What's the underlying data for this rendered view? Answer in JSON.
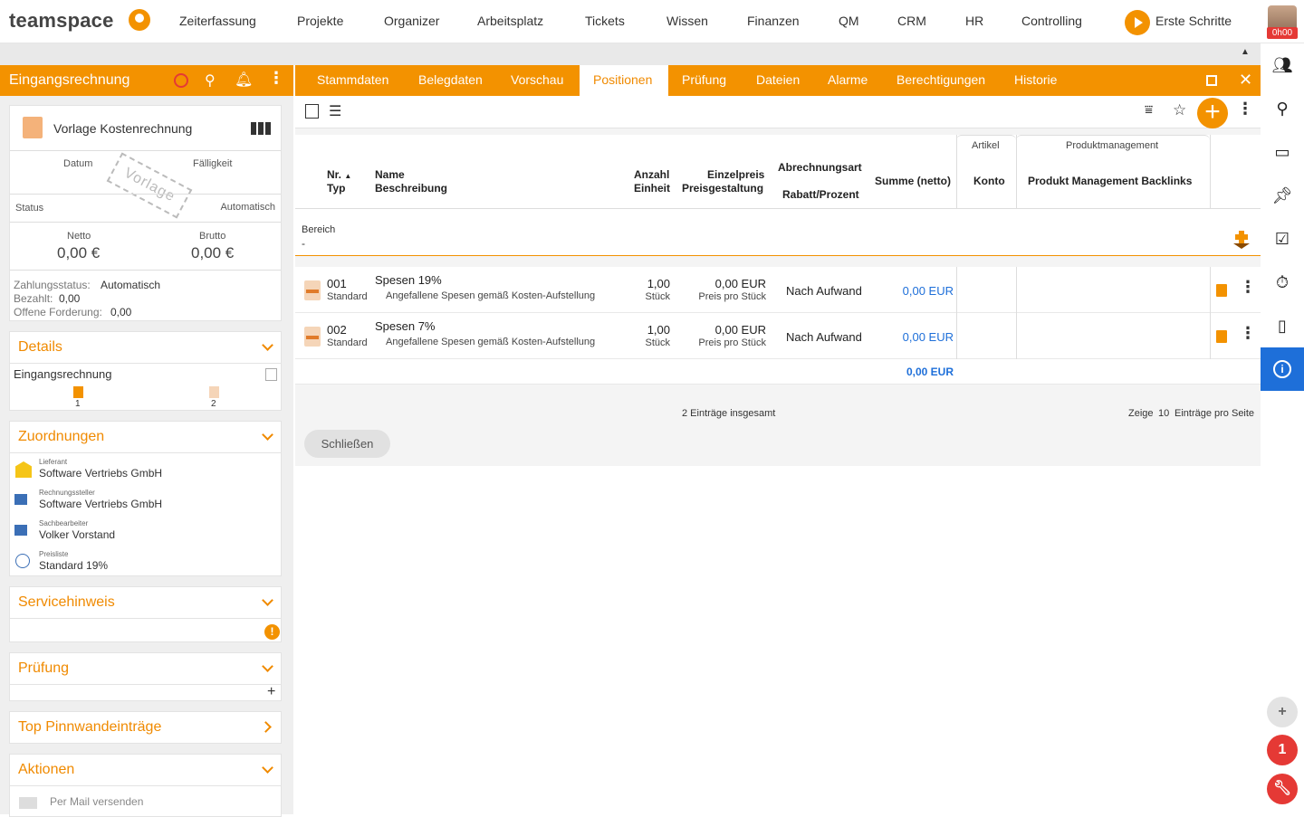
{
  "topbar": {
    "logo": "teamspace",
    "nav": [
      "Zeiterfassung",
      "Projekte",
      "Organizer",
      "Arbeitsplatz",
      "Tickets",
      "Wissen",
      "Finanzen",
      "QM",
      "CRM",
      "HR",
      "Controlling"
    ],
    "erste_schritte": "Erste Schritte",
    "avatar_badge": "0h00"
  },
  "left": {
    "title": "Eingangsrechnung",
    "template_name": "Vorlage Kostenrechnung",
    "datum_label": "Datum",
    "faelligkeit_label": "Fälligkeit",
    "stamp": "Vorlage",
    "status_label": "Status",
    "status_value": "Automatisch",
    "netto_label": "Netto",
    "netto_value": "0,00 €",
    "brutto_label": "Brutto",
    "brutto_value": "0,00 €",
    "zahlungsstatus_label": "Zahlungsstatus:",
    "zahlungsstatus_value": "Automatisch",
    "bezahlt_label": "Bezahlt:",
    "bezahlt_value": "0,00",
    "offen_label": "Offene Forderung:",
    "offen_value": "0,00",
    "details": {
      "title": "Details",
      "type": "Eingangsrechnung",
      "icon1_count": "1",
      "icon2_count": "2"
    },
    "zuordnungen": {
      "title": "Zuordnungen",
      "items": [
        {
          "label": "Lieferant",
          "value": "Software Vertriebs GmbH"
        },
        {
          "label": "Rechnungssteller",
          "value": "Software Vertriebs GmbH"
        },
        {
          "label": "Sachbearbeiter",
          "value": "Volker Vorstand"
        },
        {
          "label": "Preisliste",
          "value": "Standard 19%"
        }
      ]
    },
    "servicehinweis": {
      "title": "Servicehinweis"
    },
    "pruefung": {
      "title": "Prüfung"
    },
    "pinnwand": {
      "title": "Top Pinnwandeinträge"
    },
    "aktionen": {
      "title": "Aktionen",
      "mail": "Per Mail versenden"
    }
  },
  "tabs": [
    "Stammdaten",
    "Belegdaten",
    "Vorschau",
    "Positionen",
    "Prüfung",
    "Dateien",
    "Alarme",
    "Berechtigungen",
    "Historie"
  ],
  "active_tab": "Positionen",
  "table": {
    "headers": {
      "nr": "Nr.",
      "typ": "Typ",
      "name": "Name",
      "beschreibung": "Beschreibung",
      "anzahl": "Anzahl",
      "einheit": "Einheit",
      "einzelpreis": "Einzelpreis",
      "preisgestaltung": "Preisgestaltung",
      "abrechnungsart": "Abrechnungsart",
      "rabatt": "Rabatt/Prozent",
      "summe": "Summe (netto)",
      "artikel_group": "Artikel",
      "konto": "Konto",
      "pm_group": "Produktmanagement",
      "pm_backlinks": "Produkt Management Backlinks"
    },
    "bereich_label": "Bereich",
    "bereich_value": "-",
    "rows": [
      {
        "nr": "001",
        "typ": "Standard",
        "name": "Spesen 19%",
        "beschreibung": "Angefallene Spesen gemäß Kosten-Aufstellung",
        "anzahl": "1,00",
        "einheit": "Stück",
        "einzelpreis": "0,00 EUR",
        "preisgestaltung": "Preis pro Stück",
        "abrechnungsart": "Nach Aufwand",
        "summe": "0,00 EUR"
      },
      {
        "nr": "002",
        "typ": "Standard",
        "name": "Spesen 7%",
        "beschreibung": "Angefallene Spesen gemäß Kosten-Aufstellung",
        "anzahl": "1,00",
        "einheit": "Stück",
        "einzelpreis": "0,00 EUR",
        "preisgestaltung": "Preis pro Stück",
        "abrechnungsart": "Nach Aufwand",
        "summe": "0,00 EUR"
      }
    ],
    "total": "0,00 EUR",
    "entries_total": "2 Einträge insgesamt",
    "zeige_label": "Zeige",
    "per_page": "10",
    "per_page_suffix": "Einträge pro Seite"
  },
  "close_button": "Schließen",
  "notifications_count": "1",
  "colors": {
    "accent": "#f39200",
    "info": "#1e6fd9",
    "danger": "#e53935"
  }
}
